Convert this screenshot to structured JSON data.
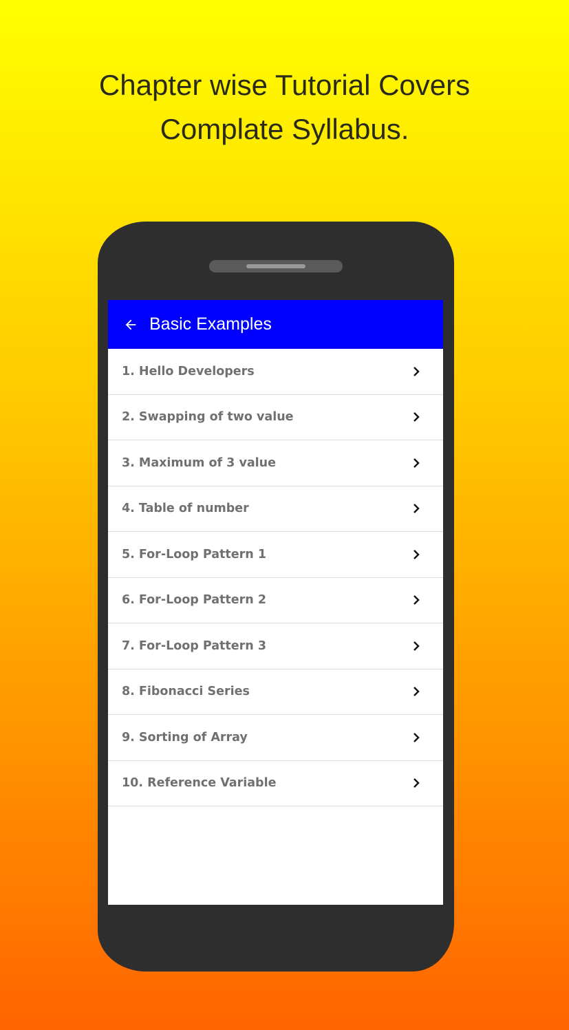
{
  "headline": {
    "line1": "Chapter wise Tutorial Covers",
    "line2": "Complate Syllabus."
  },
  "appbar": {
    "title": "Basic Examples",
    "back_icon": "arrow-left-icon",
    "color": "#0000ff"
  },
  "list": {
    "items": [
      {
        "label": "1. Hello Developers"
      },
      {
        "label": "2. Swapping of two value"
      },
      {
        "label": "3. Maximum of 3 value"
      },
      {
        "label": "4. Table of number"
      },
      {
        "label": "5. For-Loop Pattern 1"
      },
      {
        "label": "6. For-Loop Pattern 2"
      },
      {
        "label": "7. For-Loop Pattern 3"
      },
      {
        "label": "8. Fibonacci Series"
      },
      {
        "label": "9. Sorting of Array"
      },
      {
        "label": "10. Reference Variable"
      }
    ],
    "item_icon": "chevron-right-icon"
  }
}
